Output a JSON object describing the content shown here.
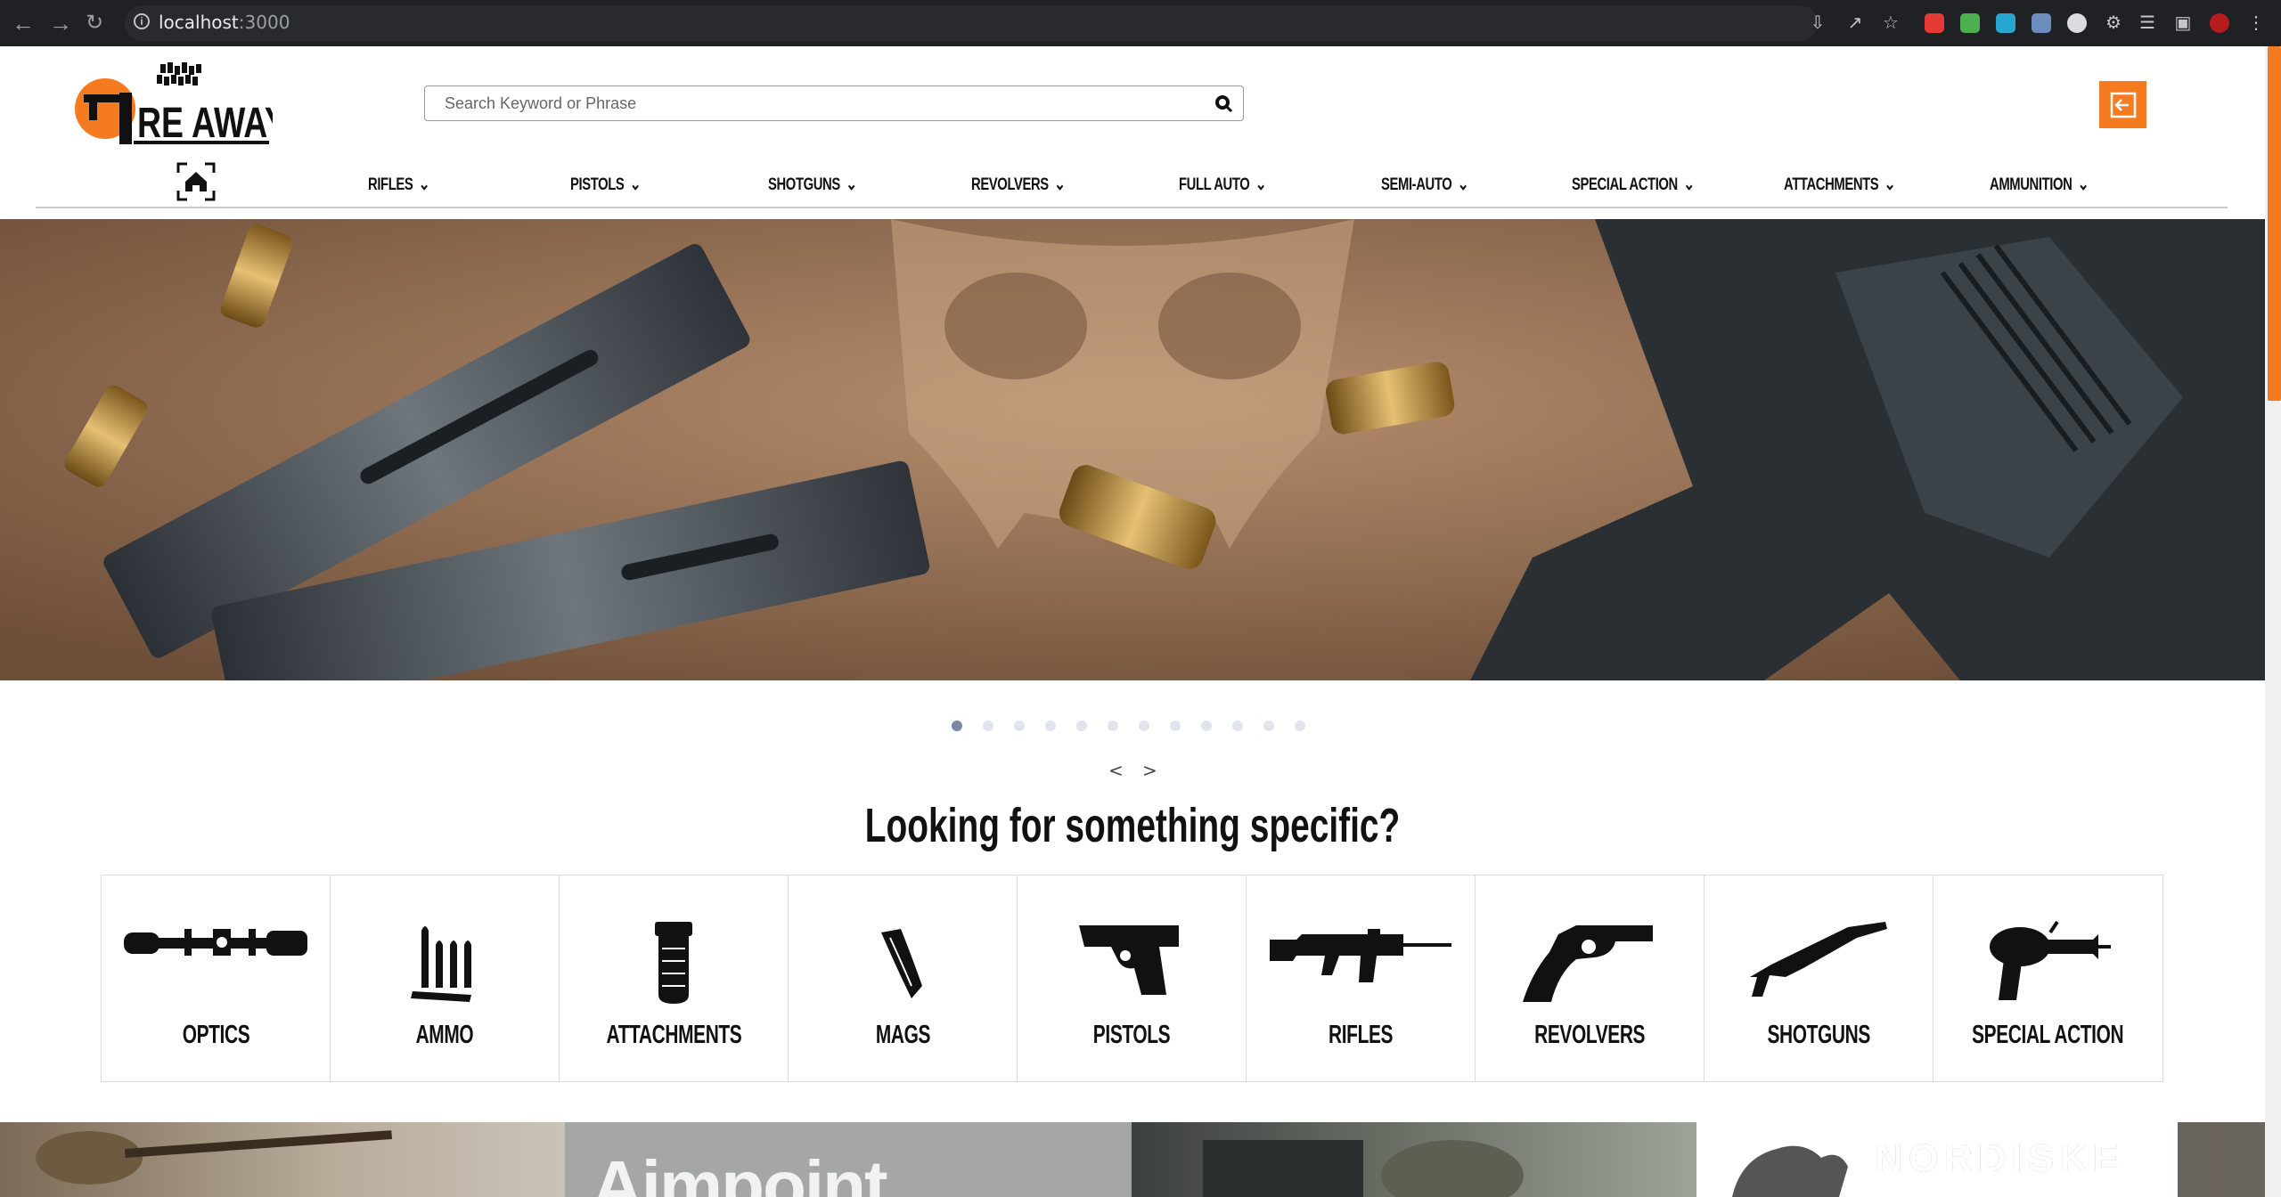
{
  "browser": {
    "url_host": "localhost",
    "url_port": ":3000"
  },
  "header": {
    "logo_text": "RE AWAY",
    "search_placeholder": "Search Keyword or Phrase",
    "brand_color": "#f47b20"
  },
  "menu": {
    "items": [
      {
        "label": "RIFLES"
      },
      {
        "label": "PISTOLS"
      },
      {
        "label": "SHOTGUNS"
      },
      {
        "label": "REVOLVERS"
      },
      {
        "label": "FULL AUTO"
      },
      {
        "label": "SEMI-AUTO"
      },
      {
        "label": "SPECIAL ACTION"
      },
      {
        "label": "ATTACHMENTS"
      },
      {
        "label": "AMMUNITION"
      }
    ]
  },
  "carousel": {
    "slide_count": 12,
    "active_index": 0,
    "prev_label": "<",
    "next_label": ">"
  },
  "section": {
    "title": "Looking for something specific?"
  },
  "categories": [
    {
      "label": "OPTICS",
      "icon": "scope-icon"
    },
    {
      "label": "AMMO",
      "icon": "ammo-icon"
    },
    {
      "label": "ATTACHMENTS",
      "icon": "grip-icon"
    },
    {
      "label": "MAGS",
      "icon": "magazine-icon"
    },
    {
      "label": "PISTOLS",
      "icon": "pistol-icon"
    },
    {
      "label": "RIFLES",
      "icon": "rifle-icon"
    },
    {
      "label": "REVOLVERS",
      "icon": "revolver-icon"
    },
    {
      "label": "SHOTGUNS",
      "icon": "shotgun-icon"
    },
    {
      "label": "SPECIAL ACTION",
      "icon": "ray-gun-icon"
    }
  ],
  "banners": [
    {
      "text": ""
    },
    {
      "text": "Aimpoint"
    },
    {
      "text": ""
    },
    {
      "text": "NORDISKE"
    }
  ]
}
